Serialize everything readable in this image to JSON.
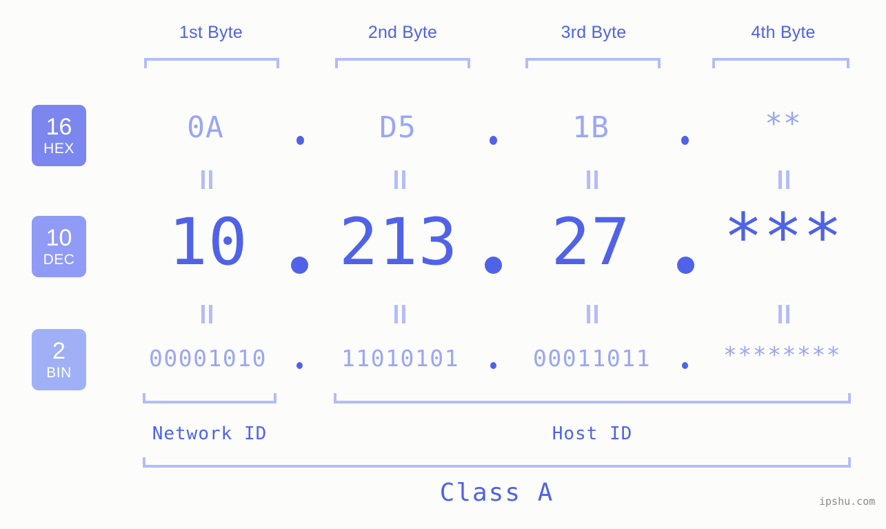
{
  "meta": {
    "background_color": "#fcfdfa",
    "accent_color": "#4f62e8",
    "light_accent_color": "#9aa6f7",
    "bracket_color": "#b3bdfb",
    "watermark": "ipshu.com"
  },
  "headers": [
    {
      "label": "1st Byte"
    },
    {
      "label": "2nd Byte"
    },
    {
      "label": "3rd Byte"
    },
    {
      "label": "4th Byte"
    }
  ],
  "bases": [
    {
      "number": "16",
      "name": "HEX",
      "color": "#7b86ee"
    },
    {
      "number": "10",
      "name": "DEC",
      "color": "#8f9bf4"
    },
    {
      "number": "2",
      "name": "BIN",
      "color": "#9fb0f7"
    }
  ],
  "rows": {
    "hex": {
      "values": [
        "0A",
        "D5",
        "1B",
        "**"
      ],
      "separator": "."
    },
    "dec": {
      "values": [
        "10",
        "213",
        "27",
        "***"
      ],
      "separator": "."
    },
    "bin": {
      "values": [
        "00001010",
        "11010101",
        "00011011",
        "********"
      ],
      "separator": "."
    }
  },
  "equals_connectors": [
    "||",
    "||",
    "||",
    "||"
  ],
  "segments": [
    {
      "label": "Network ID"
    },
    {
      "label": "Host ID"
    }
  ],
  "class": {
    "label": "Class A"
  }
}
